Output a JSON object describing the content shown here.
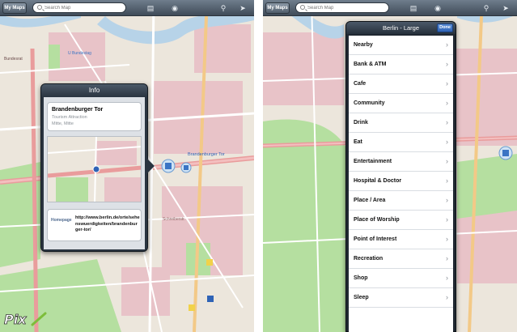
{
  "left": {
    "toolbar": {
      "my_maps": "My Maps",
      "search_placeholder": "Search Map"
    },
    "map_labels": {
      "bundesrat": "Bundesrat",
      "poi_label": "Brandenburger Tor",
      "street_bottom": "Schreiberstr.",
      "u_station": "U Bundestag"
    },
    "popover": {
      "title": "Info",
      "poi_name": "Brandenburger Tor",
      "poi_type": "Tourism Attraction",
      "poi_area": "Mitte, Mitte",
      "homepage_label": "Homepage",
      "homepage_url": "http://www.berlin.de/orte/sehenswuerdigkeiten/brandenburger-tor/"
    }
  },
  "right": {
    "toolbar": {
      "my_maps": "My Maps",
      "search_placeholder": "Search Map"
    },
    "panel": {
      "title": "Berlin - Large",
      "done": "Done",
      "items": [
        {
          "label": "Nearby"
        },
        {
          "label": "Bank & ATM"
        },
        {
          "label": "Cafe"
        },
        {
          "label": "Community"
        },
        {
          "label": "Drink"
        },
        {
          "label": "Eat"
        },
        {
          "label": "Entertainment"
        },
        {
          "label": "Hospital & Doctor"
        },
        {
          "label": "Place / Area"
        },
        {
          "label": "Place of Worship"
        },
        {
          "label": "Point of Interest"
        },
        {
          "label": "Recreation"
        },
        {
          "label": "Shop"
        },
        {
          "label": "Sleep"
        }
      ]
    }
  },
  "watermark": "Pix",
  "colors": {
    "park": "#b5dfa0",
    "water": "#b7d3e8",
    "built": "#e8c3c8",
    "road_major": "#e99c9c",
    "road_minor": "#ffffff",
    "toolbar": "#4a5664"
  }
}
